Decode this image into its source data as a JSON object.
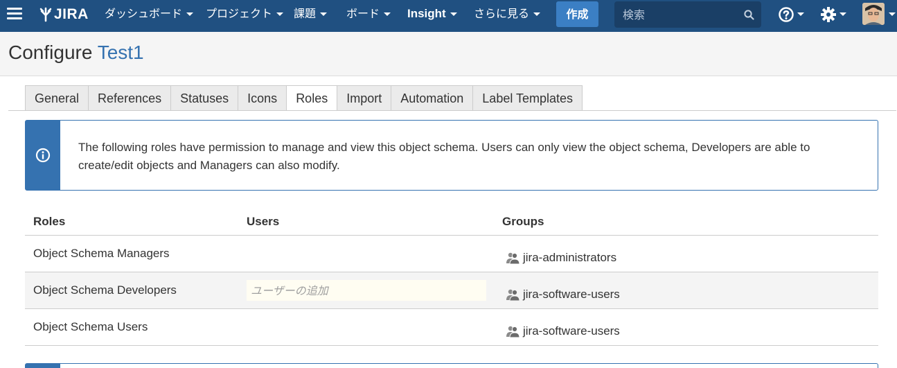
{
  "nav": {
    "logo_text": "JIRA",
    "items": [
      {
        "label": "ダッシュボード"
      },
      {
        "label": "プロジェクト"
      },
      {
        "label": "課題"
      },
      {
        "label": "ボード"
      },
      {
        "label": "Insight"
      },
      {
        "label": "さらに見る"
      }
    ],
    "create_label": "作成",
    "search_placeholder": "検索"
  },
  "page": {
    "title_prefix": "Configure",
    "title_project": "Test1"
  },
  "tabs": [
    {
      "label": "General",
      "active": false
    },
    {
      "label": "References",
      "active": false
    },
    {
      "label": "Statuses",
      "active": false
    },
    {
      "label": "Icons",
      "active": false
    },
    {
      "label": "Roles",
      "active": true
    },
    {
      "label": "Import",
      "active": false
    },
    {
      "label": "Automation",
      "active": false
    },
    {
      "label": "Label Templates",
      "active": false
    }
  ],
  "info": {
    "message": "The following roles have permission to manage and view this object schema. Users can only view the object schema, Developers are able to create/edit objects and Managers can also modify."
  },
  "roles_table": {
    "headers": {
      "roles": "Roles",
      "users": "Users",
      "groups": "Groups"
    },
    "rows": [
      {
        "role": "Object Schema Managers",
        "group": "jira-administrators"
      },
      {
        "role": "Object Schema Developers",
        "user_placeholder": "ユーザーの追加",
        "group": "jira-software-users"
      },
      {
        "role": "Object Schema Users",
        "group": "jira-software-users"
      }
    ]
  },
  "colors": {
    "nav_bg": "#205081",
    "accent": "#3572b0",
    "create_button": "#3b7fc4"
  },
  "icons": [
    "menu-icon",
    "jira-logo-icon",
    "search-icon",
    "help-icon",
    "gear-icon",
    "info-icon",
    "group-icon"
  ]
}
